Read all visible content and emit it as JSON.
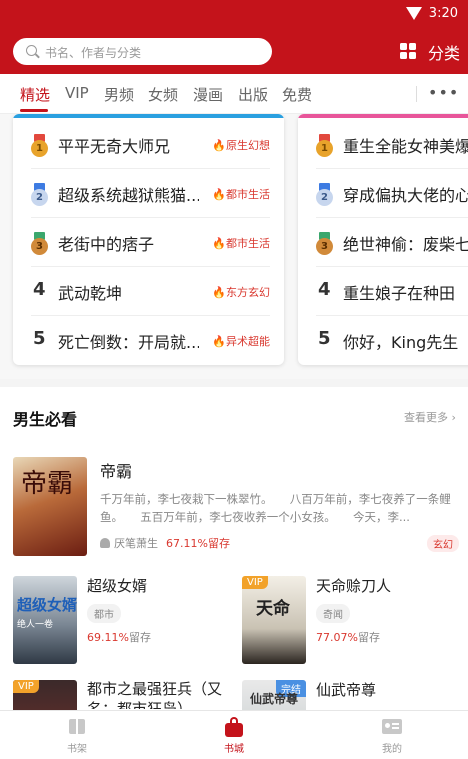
{
  "status_bar": {
    "time": "3:20"
  },
  "header": {
    "search_placeholder": "书名、作者与分类",
    "category_label": "分类"
  },
  "tabs": [
    {
      "label": "精选",
      "active": true
    },
    {
      "label": "VIP"
    },
    {
      "label": "男频"
    },
    {
      "label": "女频"
    },
    {
      "label": "漫画"
    },
    {
      "label": "出版"
    },
    {
      "label": "免费"
    }
  ],
  "more_label": "•••",
  "rank_lists": [
    {
      "accent": "#2aa0e0",
      "items": [
        {
          "rank": "1",
          "title": "平平无奇大师兄",
          "tag": "原生幻想"
        },
        {
          "rank": "2",
          "title": "超级系统越狱熊猫...",
          "tag": "都市生活"
        },
        {
          "rank": "3",
          "title": "老街中的痞子",
          "tag": "都市生活"
        },
        {
          "rank": "4",
          "title": "武动乾坤",
          "tag": "东方玄幻"
        },
        {
          "rank": "5",
          "title": "死亡倒数：开局就...",
          "tag": "异术超能"
        }
      ]
    },
    {
      "accent": "#e8559a",
      "items": [
        {
          "rank": "1",
          "title": "重生全能女神美爆"
        },
        {
          "rank": "2",
          "title": "穿成偏执大佬的心"
        },
        {
          "rank": "3",
          "title": "绝世神偷：废柴七"
        },
        {
          "rank": "4",
          "title": "重生娘子在种田"
        },
        {
          "rank": "5",
          "title": "你好，King先生"
        }
      ]
    }
  ],
  "section": {
    "title": "男生必看",
    "more": "查看更多",
    "featured": {
      "title": "帝霸",
      "cover_text": "帝霸",
      "desc": "千万年前，李七夜栽下一株翠竹。　　八百万年前，李七夜养了一条鲤鱼。　　五百万年前，李七夜收养一个小女孩。　　今天，李...",
      "author": "厌笔萧生",
      "rate": "67.11%留存",
      "tag": "玄幻"
    },
    "books": [
      {
        "title": "超级女婿",
        "tag": "都市",
        "rate_value": "69.11%",
        "rate_suffix": "留存",
        "cover_text": "超级女婿",
        "cover_sub": "绝人一卷",
        "badge": ""
      },
      {
        "title": "天命赊刀人",
        "tag": "奇闻",
        "rate_value": "77.07%",
        "rate_suffix": "留存",
        "cover_text": "天命",
        "badge": "VIP"
      },
      {
        "title": "都市之最强狂兵（又名：都市狂枭）",
        "badge": "VIP"
      },
      {
        "title": "仙武帝尊",
        "cover_text": "仙武帝尊",
        "badge": "完结"
      }
    ]
  },
  "bottom_nav": [
    {
      "label": "书架"
    },
    {
      "label": "书城",
      "active": true
    },
    {
      "label": "我的"
    }
  ],
  "colors": {
    "brand": "#c4131b",
    "tag_red": "#d9382f",
    "gold": "#e8a32b",
    "silver": "#9fb8dc",
    "bronze": "#d18a3a"
  }
}
